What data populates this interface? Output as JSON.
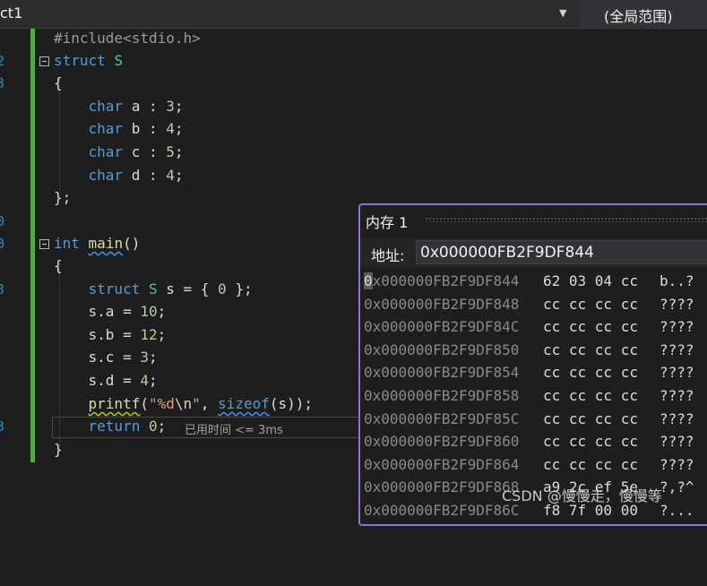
{
  "toolbar": {
    "project_combo": "ct1",
    "scope_combo": "(全局范围)"
  },
  "editor": {
    "line_numbers": [
      "",
      "2",
      "3",
      "",
      "",
      "",
      "",
      "",
      "",
      "0",
      "",
      "",
      "3",
      "",
      "",
      "",
      "",
      "3",
      "",
      ""
    ],
    "elapsed": "已用时间 <= 3ms"
  },
  "memory_window": {
    "title": "内存 1",
    "address_label": "地址:",
    "address_value": "0x000000FB2F9DF844",
    "rows": [
      {
        "addr": "0x000000FB2F9DF844",
        "bytes": "62 03 04 cc",
        "chars": "b..?"
      },
      {
        "addr": "0x000000FB2F9DF848",
        "bytes": "cc cc cc cc",
        "chars": "????"
      },
      {
        "addr": "0x000000FB2F9DF84C",
        "bytes": "cc cc cc cc",
        "chars": "????"
      },
      {
        "addr": "0x000000FB2F9DF850",
        "bytes": "cc cc cc cc",
        "chars": "????"
      },
      {
        "addr": "0x000000FB2F9DF854",
        "bytes": "cc cc cc cc",
        "chars": "????"
      },
      {
        "addr": "0x000000FB2F9DF858",
        "bytes": "cc cc cc cc",
        "chars": "????"
      },
      {
        "addr": "0x000000FB2F9DF85C",
        "bytes": "cc cc cc cc",
        "chars": "????"
      },
      {
        "addr": "0x000000FB2F9DF860",
        "bytes": "cc cc cc cc",
        "chars": "????"
      },
      {
        "addr": "0x000000FB2F9DF864",
        "bytes": "cc cc cc cc",
        "chars": "????"
      },
      {
        "addr": "0x000000FB2F9DF868",
        "bytes": "a9 2c ef 5e",
        "chars": "?,?^"
      },
      {
        "addr": "0x000000FB2F9DF86C",
        "bytes": "f8 7f 00 00",
        "chars": "?..."
      }
    ]
  },
  "watermark": "CSDN @慢慢走，慢慢等",
  "colors": {
    "accent_border": "#8b73d1",
    "change_bar": "#57a64a"
  }
}
